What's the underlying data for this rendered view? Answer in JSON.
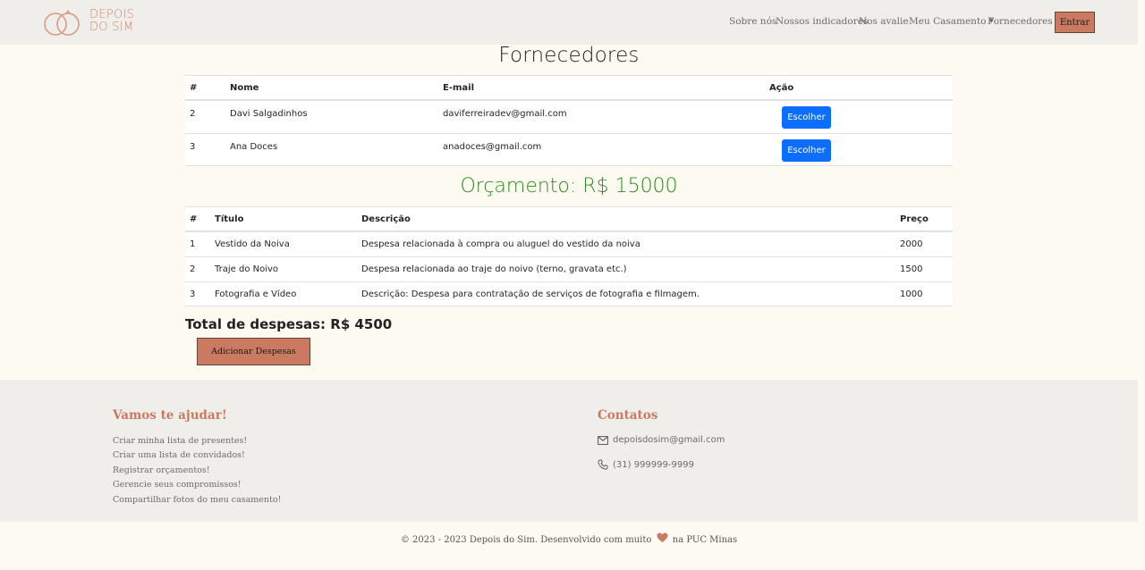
{
  "brand": {
    "line1": "DEPOIS",
    "line2": "DO SIM"
  },
  "nav": {
    "items": [
      "Sobre nós",
      "Nossos indicadores",
      "Nos avalie",
      "Meu Casamento",
      "Fornecedores"
    ],
    "login": "Entrar"
  },
  "suppliers": {
    "title": "Fornecedores",
    "headers": [
      "#",
      "Nome",
      "E-mail",
      "Ação"
    ],
    "rows": [
      {
        "id": "2",
        "name": "Davi Salgadinhos",
        "email": "daviferreiradev@gmail.com",
        "action": "Escolher"
      },
      {
        "id": "3",
        "name": "Ana Doces",
        "email": "anadoces@gmail.com",
        "action": "Escolher"
      }
    ]
  },
  "budget": {
    "title": "Orçamento: R$ 15000",
    "headers": [
      "#",
      "Título",
      "Descrição",
      "Preço"
    ],
    "rows": [
      {
        "id": "1",
        "title": "Vestido da Noiva",
        "description": "Despesa relacionada à compra ou aluguel do vestido da noiva",
        "price": "2000"
      },
      {
        "id": "2",
        "title": "Traje do Noivo",
        "description": "Despesa relacionada ao traje do noivo (terno, gravata etc.)",
        "price": "1500"
      },
      {
        "id": "3",
        "title": "Fotografia e Vídeo",
        "description": "Descrição: Despesa para contratação de serviços de fotografia e filmagem.",
        "price": "1000"
      }
    ],
    "total": "Total de despesas: R$ 4500",
    "add_button": "Adicionar Despesas"
  },
  "footer": {
    "help_title": "Vamos te ajudar!",
    "help_links": [
      "Criar minha lista de presentes!",
      "Criar uma lista de convidados!",
      "Registrar orçamentos!",
      "Gerencie seus compromissos!",
      "Compartilhar fotos do meu casamento!"
    ],
    "contacts_title": "Contatos",
    "email": "depoisdosim@gmail.com",
    "phone": "(31) 999999-9999",
    "copyright_pre": "© 2023 - 2023 Depois do Sim. Desenvolvido com muito",
    "copyright_post": "na PUC Minas"
  },
  "colors": {
    "brand": "#c97a61",
    "primary_button": "#0d6efd",
    "budget_title": "#2f8a1d"
  },
  "icons": [
    "rings-logo-icon",
    "envelope-icon",
    "phone-icon",
    "heart-icon",
    "caret-down-icon"
  ]
}
